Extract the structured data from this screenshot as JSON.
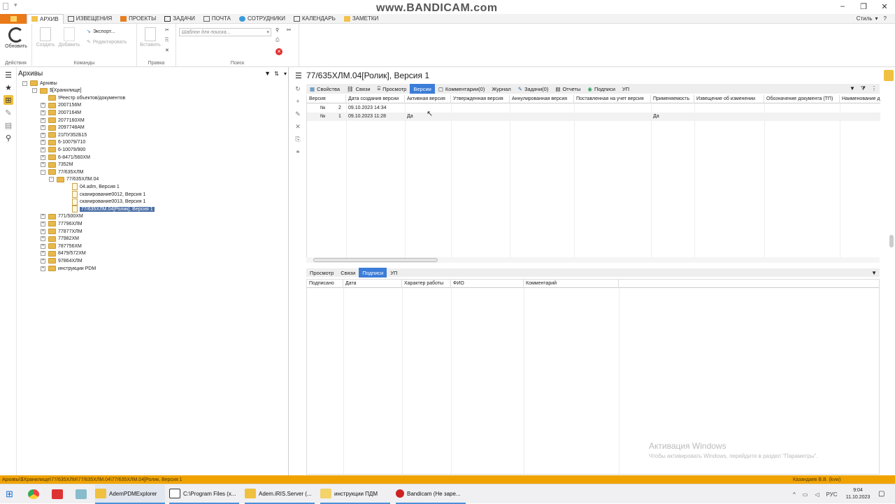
{
  "watermark": "www.BANDICAM.com",
  "ribbon_tabs": [
    "АРХИВ",
    "ИЗВЕЩЕНИЯ",
    "ПРОЕКТЫ",
    "ЗАДАЧИ",
    "ПОЧТА",
    "СОТРУДНИКИ",
    "КАЛЕНДАРЬ",
    "ЗАМЕТКИ"
  ],
  "style_label": "Стиль",
  "ribbon": {
    "refresh": "Обновить",
    "create": "Создать",
    "add": "Добавить",
    "export": "Экспорт...",
    "edit": "Редактировать",
    "paste": "Вставить",
    "search_placeholder": "Шаблон для поиска...",
    "groups": {
      "actions": "Действия",
      "commands": "Команды",
      "edit": "Правка",
      "search": "Поиск"
    }
  },
  "archives": {
    "title": "Архивы",
    "tree": [
      {
        "label": "Архивы",
        "depth": 0,
        "type": "folder",
        "exp": "-"
      },
      {
        "label": "$[Хранилище]",
        "depth": 1,
        "type": "store",
        "exp": "-"
      },
      {
        "label": "!Реестр объектов/документов",
        "depth": 2,
        "type": "folder",
        "exp": ""
      },
      {
        "label": "2007156М",
        "depth": 2,
        "type": "folder",
        "exp": "+"
      },
      {
        "label": "2007164М",
        "depth": 2,
        "type": "folder",
        "exp": "+"
      },
      {
        "label": "2077160ХМ",
        "depth": 2,
        "type": "folder",
        "exp": "+"
      },
      {
        "label": "2097748АМ",
        "depth": 2,
        "type": "folder",
        "exp": "+"
      },
      {
        "label": "21ПУ352Б15",
        "depth": 2,
        "type": "folder",
        "exp": "+"
      },
      {
        "label": "6-10079/710",
        "depth": 2,
        "type": "folder",
        "exp": "+"
      },
      {
        "label": "6-10079/900",
        "depth": 2,
        "type": "folder",
        "exp": "+"
      },
      {
        "label": "6-8471/560ХМ",
        "depth": 2,
        "type": "folder",
        "exp": "+"
      },
      {
        "label": "7352М",
        "depth": 2,
        "type": "folder",
        "exp": "+"
      },
      {
        "label": "77/635ХЛМ",
        "depth": 2,
        "type": "folder",
        "exp": "-"
      },
      {
        "label": "77/635ХЛМ.04",
        "depth": 3,
        "type": "folder",
        "exp": "-"
      },
      {
        "label": "04.adm, Версия 1",
        "depth": 4,
        "type": "doc",
        "exp": ""
      },
      {
        "label": "сканирование0012, Версия 1",
        "depth": 4,
        "type": "doc",
        "exp": ""
      },
      {
        "label": "сканирование0013, Версия 1",
        "depth": 4,
        "type": "doc",
        "exp": ""
      },
      {
        "label": "77/635ХЛМ.04[Ролик], Версия 1",
        "depth": 4,
        "type": "doc",
        "exp": "",
        "selected": true
      },
      {
        "label": "771/500ХМ",
        "depth": 2,
        "type": "folder",
        "exp": "+"
      },
      {
        "label": "77796ХЛМ",
        "depth": 2,
        "type": "folder",
        "exp": "+"
      },
      {
        "label": "77877ХЛМ",
        "depth": 2,
        "type": "folder",
        "exp": "+"
      },
      {
        "label": "77982ХМ",
        "depth": 2,
        "type": "folder",
        "exp": "+"
      },
      {
        "label": "787756ХМ",
        "depth": 2,
        "type": "folder",
        "exp": "+"
      },
      {
        "label": "8479/572ХМ",
        "depth": 2,
        "type": "folder",
        "exp": "+"
      },
      {
        "label": "97864ХЛМ",
        "depth": 2,
        "type": "folder",
        "exp": "+"
      },
      {
        "label": "инструкции PDM",
        "depth": 2,
        "type": "folder",
        "exp": "+"
      }
    ]
  },
  "main": {
    "title": "77/635ХЛМ.04[Ролик], Версия 1",
    "toolbar": [
      "Свойства",
      "Связи",
      "Просмотр",
      "Версии",
      "Комментарии(0)",
      "Журнал",
      "Задачи(0)",
      "Отчеты",
      "Подписи",
      "УП"
    ],
    "versions_columns": [
      "Версия",
      "Дата создания версии",
      "Активная версия",
      "Утвержденная версия",
      "Аннулированная версия",
      "Поставленная на учет версия",
      "Применяемость",
      "Извещение об изменении",
      "Обозначение документа (ТП)",
      "Наименование д"
    ],
    "versions_rows": [
      {
        "prefix": "№",
        "num": "2",
        "date": "09.10.2023 14:34",
        "active": "",
        "applic": ""
      },
      {
        "prefix": "№",
        "num": "1",
        "date": "09.10.2023 11:28",
        "active": "Да",
        "applic": "Да"
      }
    ],
    "bottom_tabs": [
      "Просмотр",
      "Связи",
      "Подписи",
      "УП"
    ],
    "sign_columns": [
      "Подписано",
      "Дата",
      "Характер работы",
      "ФИО",
      "Комментарий"
    ]
  },
  "status": {
    "path": "Архивы\\$Хранилище\\77/635ХЛМ\\77/635ХЛМ.04\\77/635ХЛМ.04[Ролик, Версия 1",
    "user": "Казандаев В.В. (kvw)"
  },
  "activation": {
    "title": "Активация Windows",
    "text": "Чтобы активировать Windows, перейдите в раздел \"Параметры\"."
  },
  "taskbar": {
    "apps": [
      "AdemPDMExplorer",
      "C:\\Program Files (x...",
      "Adem.iRIS.Server (...",
      "инструкции ПДМ",
      "Bandicam (Не заре..."
    ],
    "lang": "РУС",
    "time": "9:04",
    "date": "11.10.2023"
  }
}
